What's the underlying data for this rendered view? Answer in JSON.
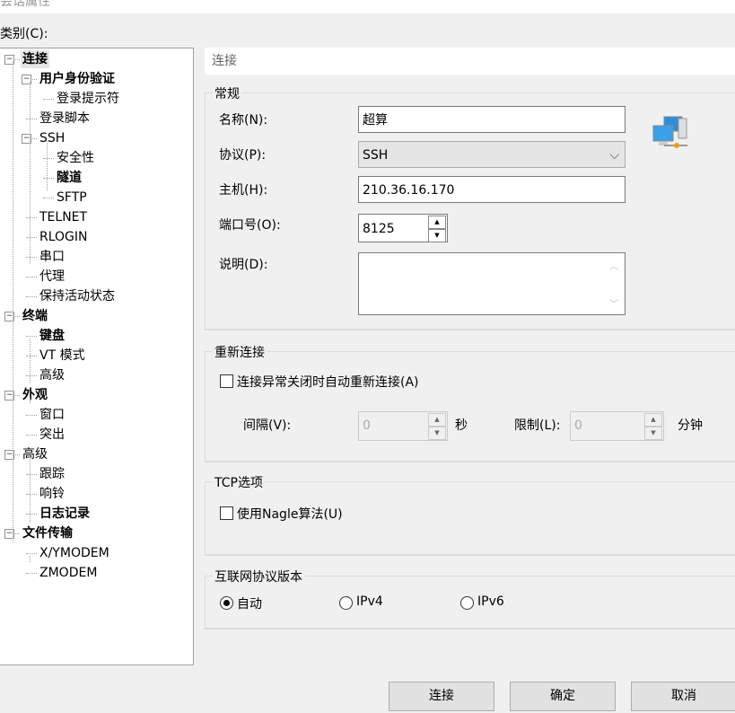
{
  "window": {
    "title": "会话属性"
  },
  "category_label": "类别(C):",
  "tree": [
    {
      "label": "连接",
      "level": 0,
      "bold": true,
      "expanded": true,
      "selected": true
    },
    {
      "label": "用户身份验证",
      "level": 1,
      "bold": true,
      "expanded": true
    },
    {
      "label": "登录提示符",
      "level": 2
    },
    {
      "label": "登录脚本",
      "level": 1
    },
    {
      "label": "SSH",
      "level": 1,
      "expanded": true
    },
    {
      "label": "安全性",
      "level": 2
    },
    {
      "label": "隧道",
      "level": 2,
      "bold": true
    },
    {
      "label": "SFTP",
      "level": 2
    },
    {
      "label": "TELNET",
      "level": 1
    },
    {
      "label": "RLOGIN",
      "level": 1
    },
    {
      "label": "串口",
      "level": 1
    },
    {
      "label": "代理",
      "level": 1
    },
    {
      "label": "保持活动状态",
      "level": 1
    },
    {
      "label": "终端",
      "level": 0,
      "bold": true,
      "expanded": true
    },
    {
      "label": "键盘",
      "level": 1,
      "bold": true
    },
    {
      "label": "VT 模式",
      "level": 1
    },
    {
      "label": "高级",
      "level": 1
    },
    {
      "label": "外观",
      "level": 0,
      "bold": true,
      "expanded": true
    },
    {
      "label": "窗口",
      "level": 1
    },
    {
      "label": "突出",
      "level": 1
    },
    {
      "label": "高级",
      "level": 0,
      "expanded": true
    },
    {
      "label": "跟踪",
      "level": 1
    },
    {
      "label": "响铃",
      "level": 1
    },
    {
      "label": "日志记录",
      "level": 1,
      "bold": true
    },
    {
      "label": "文件传输",
      "level": 0,
      "bold": true,
      "expanded": true
    },
    {
      "label": "X/YMODEM",
      "level": 1
    },
    {
      "label": "ZMODEM",
      "level": 1
    }
  ],
  "panel": {
    "header": "连接",
    "general": {
      "title": "常规",
      "name_label": "名称(N):",
      "name_value": "超算",
      "protocol_label": "协议(P):",
      "protocol_value": "SSH",
      "host_label": "主机(H):",
      "host_value": "210.36.16.170",
      "port_label": "端口号(O):",
      "port_value": "8125",
      "desc_label": "说明(D):",
      "desc_value": ""
    },
    "reconnect": {
      "title": "重新连接",
      "checkbox_label": "连接异常关闭时自动重新连接(A)",
      "checked": false,
      "interval_label": "间隔(V):",
      "interval_value": "0",
      "interval_unit": "秒",
      "limit_label": "限制(L):",
      "limit_value": "0",
      "limit_unit": "分钟"
    },
    "tcp": {
      "title": "TCP选项",
      "nagle_label": "使用Nagle算法(U)",
      "checked": false
    },
    "ipver": {
      "title": "互联网协议版本",
      "options": [
        "自动",
        "IPv4",
        "IPv6"
      ],
      "selected": "自动"
    }
  },
  "buttons": {
    "connect": "连接",
    "ok": "确定",
    "cancel": "取消"
  }
}
